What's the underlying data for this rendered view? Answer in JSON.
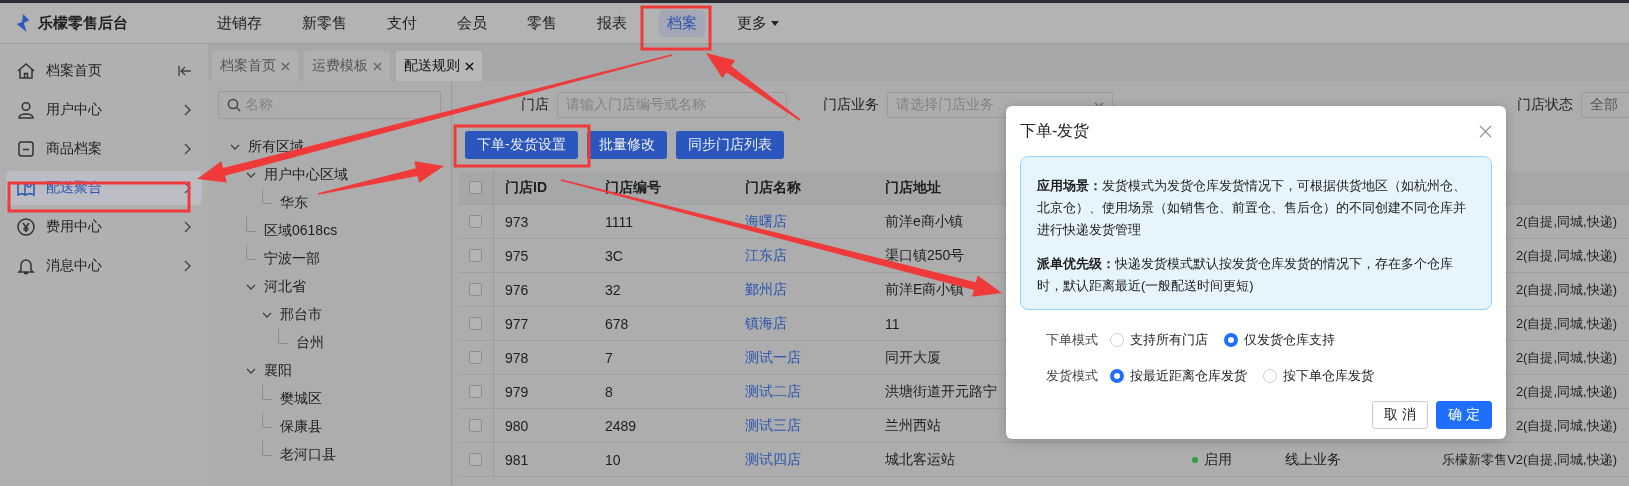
{
  "app": {
    "name": "乐檬零售后台"
  },
  "top_nav": [
    {
      "label": "进销存",
      "selected": false,
      "has_menu": false
    },
    {
      "label": "新零售",
      "selected": false,
      "has_menu": false
    },
    {
      "label": "支付",
      "selected": false,
      "has_menu": false
    },
    {
      "label": "会员",
      "selected": false,
      "has_menu": false
    },
    {
      "label": "零售",
      "selected": false,
      "has_menu": false
    },
    {
      "label": "报表",
      "selected": false,
      "has_menu": false
    },
    {
      "label": "档案",
      "selected": true,
      "has_menu": false
    },
    {
      "label": "更多",
      "selected": false,
      "has_menu": true
    }
  ],
  "sidebar": {
    "items": [
      {
        "label": "档案首页",
        "selected": false,
        "chevron": false
      },
      {
        "label": "用户中心",
        "selected": false,
        "chevron": true
      },
      {
        "label": "商品档案",
        "selected": false,
        "chevron": true
      },
      {
        "label": "配送聚合",
        "selected": true,
        "chevron": true
      },
      {
        "label": "费用中心",
        "selected": false,
        "chevron": true
      },
      {
        "label": "消息中心",
        "selected": false,
        "chevron": true
      }
    ]
  },
  "tabs": [
    {
      "label": "档案首页",
      "selected": false
    },
    {
      "label": "运费模板",
      "selected": false
    },
    {
      "label": "配送规则",
      "selected": true
    }
  ],
  "tree": {
    "search_placeholder": "名称",
    "nodes": [
      {
        "label": "所有区域",
        "expanded": true,
        "children": [
          {
            "label": "用户中心区域",
            "expanded": true,
            "children": [
              {
                "label": "华东"
              }
            ]
          },
          {
            "label": "区域0618cs"
          },
          {
            "label": "宁波一部"
          },
          {
            "label": "河北省",
            "expanded": true,
            "children": [
              {
                "label": "邢台市",
                "expanded": true,
                "children": [
                  {
                    "label": "台州"
                  }
                ]
              }
            ]
          },
          {
            "label": "襄阳",
            "expanded": true,
            "children": [
              {
                "label": "樊城区"
              },
              {
                "label": "保康县"
              },
              {
                "label": "老河口县"
              }
            ]
          }
        ]
      }
    ]
  },
  "filters": [
    {
      "label": "门店",
      "placeholder": "请输入门店编号或名称",
      "caret": false
    },
    {
      "label": "门店业务",
      "placeholder": "请选择门店业务",
      "caret": true
    },
    {
      "label": "门店状态",
      "value": "全部",
      "caret": false
    }
  ],
  "actions": [
    "下单-发货设置",
    "批量修改",
    "同步门店列表"
  ],
  "table": {
    "all_checked": false,
    "columns": [
      "门店ID",
      "门店编号",
      "门店名称",
      "门店地址"
    ],
    "rows": [
      {
        "checked": false,
        "id": "973",
        "code": "1111",
        "name": "海曙店",
        "address": "前洋e商小镇",
        "delivery": "2(自提,同城,快递)"
      },
      {
        "checked": false,
        "id": "975",
        "code": "3C",
        "name": "江东店",
        "address": "渠口镇250号",
        "delivery": "2(自提,同城,快递)"
      },
      {
        "checked": false,
        "id": "976",
        "code": "32",
        "name": "鄞州店",
        "address": "前洋E商小镇",
        "delivery": "2(自提,同城,快递)"
      },
      {
        "checked": false,
        "id": "977",
        "code": "678",
        "name": "镇海店",
        "address": "11",
        "delivery": "2(自提,同城,快递)"
      },
      {
        "checked": false,
        "id": "978",
        "code": "7",
        "name": "测试一店",
        "address": "同开大厦",
        "delivery": "2(自提,同城,快递)"
      },
      {
        "checked": false,
        "id": "979",
        "code": "8",
        "name": "测试二店",
        "address": "洪塘街道开元路宁",
        "delivery": "2(自提,同城,快递)"
      },
      {
        "checked": false,
        "id": "980",
        "code": "2489",
        "name": "测试三店",
        "address": "兰州西站",
        "delivery": "2(自提,同城,快递)"
      },
      {
        "checked": false,
        "id": "981",
        "code": "10",
        "name": "测试四店",
        "address": "城北客运站",
        "status": {
          "label": "启用",
          "color": "#2e9e3e"
        },
        "business": "线上业务",
        "delivery": "乐檬新零售V2(自提,同城,快递)"
      }
    ]
  },
  "dialog": {
    "title": "下单-发货",
    "notes": [
      "**应用场景：**发货模式为发货仓库发货情况下，可根据供货地区（如杭州仓、北京仓）、使用场景（如销售仓、前置仓、售后仓）的不同创建不同仓库并进行快递发货管理",
      "**派单优先级：**快递发货模式默认按发货仓库发货的情况下，存在多个仓库时，默认距离最近(一般配送时间更短)"
    ],
    "options": [
      {
        "label": "下单模式",
        "choices": [
          {
            "label": "支持所有门店",
            "selected": false
          },
          {
            "label": "仅发货仓库支持",
            "selected": true
          }
        ]
      },
      {
        "label": "发货模式",
        "choices": [
          {
            "label": "按最近距离仓库发货",
            "selected": true
          },
          {
            "label": "按下单仓库发货",
            "selected": false
          }
        ]
      }
    ],
    "buttons": [
      {
        "label": "取 消",
        "kind": "default"
      },
      {
        "label": "确 定",
        "kind": "primary"
      }
    ]
  }
}
